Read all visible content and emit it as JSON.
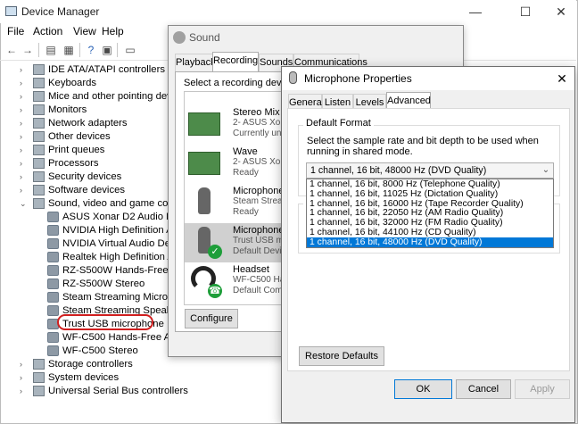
{
  "device_manager": {
    "title": "Device Manager",
    "menu": [
      "File",
      "Action",
      "View",
      "Help"
    ],
    "window_controls": {
      "minimize": "—",
      "maximize": "☐",
      "close": "✕"
    },
    "tree": [
      {
        "label": "IDE ATA/ATAPI controllers",
        "level": 1,
        "expander": "›"
      },
      {
        "label": "Keyboards",
        "level": 1,
        "expander": "›"
      },
      {
        "label": "Mice and other pointing devices",
        "level": 1,
        "expander": "›"
      },
      {
        "label": "Monitors",
        "level": 1,
        "expander": "›"
      },
      {
        "label": "Network adapters",
        "level": 1,
        "expander": "›"
      },
      {
        "label": "Other devices",
        "level": 1,
        "expander": "›"
      },
      {
        "label": "Print queues",
        "level": 1,
        "expander": "›"
      },
      {
        "label": "Processors",
        "level": 1,
        "expander": "›"
      },
      {
        "label": "Security devices",
        "level": 1,
        "expander": "›"
      },
      {
        "label": "Software devices",
        "level": 1,
        "expander": "›"
      },
      {
        "label": "Sound, video and game controllers",
        "level": 1,
        "expander": "⌄"
      },
      {
        "label": "ASUS Xonar D2 Audio Device",
        "level": 2,
        "expander": ""
      },
      {
        "label": "NVIDIA High Definition Audio",
        "level": 2,
        "expander": ""
      },
      {
        "label": "NVIDIA Virtual Audio Device (Wave Extensible) (WDM)",
        "level": 2,
        "expander": ""
      },
      {
        "label": "Realtek High Definition Audio",
        "level": 2,
        "expander": ""
      },
      {
        "label": "RZ-S500W Hands-Free AG Audio",
        "level": 2,
        "expander": ""
      },
      {
        "label": "RZ-S500W Stereo",
        "level": 2,
        "expander": ""
      },
      {
        "label": "Steam Streaming Microphone",
        "level": 2,
        "expander": ""
      },
      {
        "label": "Steam Streaming Speakers",
        "level": 2,
        "expander": ""
      },
      {
        "label": "Trust USB microphone",
        "level": 2,
        "expander": ""
      },
      {
        "label": "WF-C500 Hands-Free AG Audio",
        "level": 2,
        "expander": ""
      },
      {
        "label": "WF-C500 Stereo",
        "level": 2,
        "expander": ""
      },
      {
        "label": "Storage controllers",
        "level": 1,
        "expander": "›"
      },
      {
        "label": "System devices",
        "level": 1,
        "expander": "›"
      },
      {
        "label": "Universal Serial Bus controllers",
        "level": 1,
        "expander": "›"
      }
    ]
  },
  "sound": {
    "title": "Sound",
    "tabs": [
      "Playback",
      "Recording",
      "Sounds",
      "Communications"
    ],
    "active_tab": "Recording",
    "instruction": "Select a recording device b",
    "devices": [
      {
        "name": "Stereo Mix",
        "line1": "2- ASUS Xonar",
        "line2": "Currently una",
        "icon": "sound-card-icon"
      },
      {
        "name": "Wave",
        "line1": "2- ASUS Xonar",
        "line2": "Ready",
        "icon": "sound-card-icon"
      },
      {
        "name": "Microphone",
        "line1": "Steam Stream",
        "line2": "Ready",
        "icon": "microphone-icon"
      },
      {
        "name": "Microphone",
        "line1": "Trust USB mi",
        "line2": "Default Devi",
        "icon": "microphone-default-icon"
      },
      {
        "name": "Headset",
        "line1": "WF-C500 Han",
        "line2": "Default Comm",
        "icon": "headset-icon"
      }
    ],
    "configure_label": "Configure"
  },
  "mic_props": {
    "title": "Microphone Properties",
    "close": "✕",
    "tabs": [
      "General",
      "Listen",
      "Levels",
      "Advanced"
    ],
    "active_tab": "Advanced",
    "group_label": "Default Format",
    "description": "Select the sample rate and bit depth to be used when running in shared mode.",
    "selected_format": "1 channel, 16 bit, 48000 Hz (DVD Quality)",
    "options": [
      "1 channel, 16 bit, 8000 Hz (Telephone Quality)",
      "1 channel, 16 bit, 11025 Hz (Dictation Quality)",
      "1 channel, 16 bit, 16000 Hz (Tape Recorder Quality)",
      "1 channel, 16 bit, 22050 Hz (AM Radio Quality)",
      "1 channel, 16 bit, 32000 Hz (FM Radio Quality)",
      "1 channel, 16 bit, 44100 Hz (CD Quality)",
      "1 channel, 16 bit, 48000 Hz (DVD Quality)"
    ],
    "second_group_initial": "E",
    "restore_defaults": "Restore Defaults",
    "ok": "OK",
    "cancel": "Cancel",
    "apply": "Apply"
  }
}
